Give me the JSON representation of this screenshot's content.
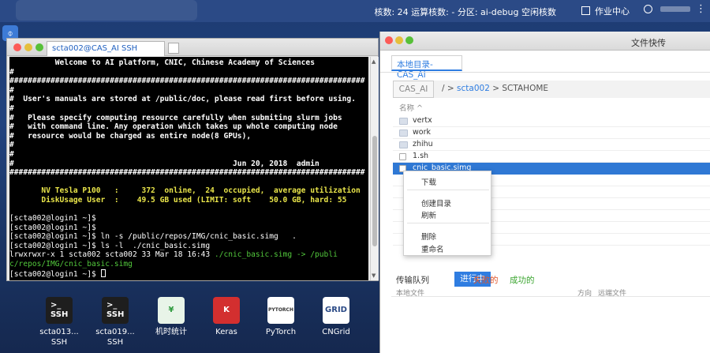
{
  "topbar": {
    "status": "核数: 24 运算核数: - 分区: ai-debug 空闲核数",
    "center": "作业中心",
    "more": "⋮"
  },
  "ssh": {
    "tab_title": "scta002@CAS_AI SSH",
    "lines": [
      {
        "text": "          Welcome to AI platform, CNIC, Chinese Academy of Sciences",
        "style": "bold"
      },
      {
        "text": "#",
        "style": "bold"
      },
      {
        "text": "##############################################################################",
        "style": "bold"
      },
      {
        "text": "#",
        "style": "bold"
      },
      {
        "text": "#  User's manuals are stored at /public/doc, please read first before using.",
        "style": "bold"
      },
      {
        "text": "#",
        "style": "bold"
      },
      {
        "text": "#   Please specify computing resource carefully when submiting slurm jobs",
        "style": "bold"
      },
      {
        "text": "#   with command line. Any operation which takes up whole computing node",
        "style": "bold"
      },
      {
        "text": "#   resource would be charged as entire node(8 GPUs),",
        "style": "bold"
      },
      {
        "text": "#",
        "style": "bold"
      },
      {
        "text": "#",
        "style": "bold"
      },
      {
        "text": "#                                                Jun 20, 2018  admin",
        "style": "bold"
      },
      {
        "text": "##############################################################################",
        "style": "bold"
      },
      {
        "text": "",
        "style": "bold"
      },
      {
        "text": "       NV Tesla P100   :     372  online,  24  occupied,  average utilization",
        "style": "yellow"
      },
      {
        "text": "       DiskUsage User  :    49.5 GB used (LIMIT: soft    50.0 GB, hard: 55",
        "style": "yellow"
      },
      {
        "text": "",
        "style": "normal"
      },
      {
        "text": "[scta002@login1 ~]$",
        "style": "normal"
      },
      {
        "text": "[scta002@login1 ~]$",
        "style": "normal"
      },
      {
        "text": "[scta002@login1 ~]$ ln -s /public/repos/IMG/cnic_basic.simg   .",
        "style": "normal"
      },
      {
        "text": "[scta002@login1 ~]$ ls -l  ./cnic_basic.simg",
        "style": "normal"
      },
      {
        "text": "lrwxrwxr-x 1 scta002 scta002 33 Mar 18 16:43 ",
        "style": "normal",
        "extra": "./cnic_basic.simg",
        "tail": " -> /publi"
      },
      {
        "text": "c/repos/IMG/cnic_basic.simg",
        "style": "green"
      },
      {
        "text": "[scta002@login1 ~]$ ",
        "style": "normal",
        "cursor": true
      }
    ]
  },
  "desktop_icons": [
    {
      "label": "scta013...\nSSH",
      "tile_text": ">_\nSSH",
      "bg": "#1e1e1e",
      "fg": "#ffffff"
    },
    {
      "label": "scta019...\nSSH",
      "tile_text": ">_\nSSH",
      "bg": "#1e1e1e",
      "fg": "#ffffff"
    },
    {
      "label": "机时统计",
      "tile_text": "¥",
      "bg": "#e8f4e8",
      "fg": "#2e9a3e"
    },
    {
      "label": "Keras",
      "tile_text": "K",
      "bg": "#d32f2f",
      "fg": "#ffffff"
    },
    {
      "label": "PyTorch",
      "tile_text": "PYTORCH",
      "bg": "#ffffff",
      "fg": "#333333"
    },
    {
      "label": "CNGrid",
      "tile_text": "GRID",
      "bg": "#ffffff",
      "fg": "#2b4a86"
    }
  ],
  "filetransfer": {
    "title": "文件快传",
    "tab": "本地目录-CAS_AI",
    "root": "CAS_AI",
    "path_sep1": "/",
    "path_sep2": ">",
    "path_user": "scta002",
    "path_home": "SCTAHOME",
    "col_name": "名称 ^",
    "files": [
      {
        "name": "vertx",
        "type": "folder"
      },
      {
        "name": "work",
        "type": "folder"
      },
      {
        "name": "zhihu",
        "type": "folder"
      },
      {
        "name": "1.sh",
        "type": "file"
      },
      {
        "name": "cnic_basic.simg",
        "type": "file",
        "selected": true
      }
    ],
    "context_menu": [
      "下载",
      "创建目录",
      "刷新",
      "删除",
      "重命名"
    ],
    "queue_label": "传输队列",
    "queue_running": "进行中",
    "queue_failed": "失败的",
    "queue_success": "成功的",
    "q_local": "本地文件",
    "q_dir": "方向",
    "q_remote": "远端文件"
  }
}
